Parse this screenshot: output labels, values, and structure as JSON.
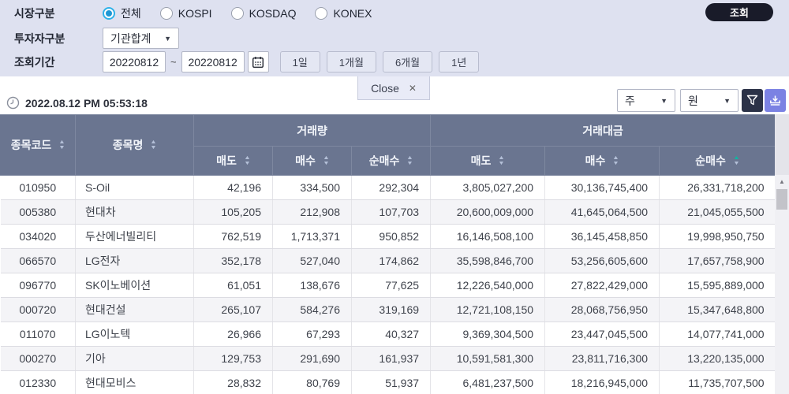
{
  "filters": {
    "market": {
      "label": "시장구분",
      "options": [
        {
          "label": "전체",
          "selected": true
        },
        {
          "label": "KOSPI",
          "selected": false
        },
        {
          "label": "KOSDAQ",
          "selected": false
        },
        {
          "label": "KONEX",
          "selected": false
        }
      ]
    },
    "investor": {
      "label": "투자자구분",
      "value": "기관합계"
    },
    "period": {
      "label": "조회기간",
      "from": "20220812",
      "separator": "~",
      "to": "20220812",
      "ranges": [
        "1일",
        "1개월",
        "6개월",
        "1년"
      ]
    },
    "search_button": "조회"
  },
  "tab": {
    "label": "Close",
    "close_icon": "✕"
  },
  "statusbar": {
    "timestamp": "2022.08.12 PM 05:53:18",
    "period_unit_select": "주",
    "currency_unit_select": "원"
  },
  "table": {
    "columns": {
      "code": "종목코드",
      "name": "종목명",
      "volume_group": "거래량",
      "value_group": "거래대금"
    },
    "sub_columns": [
      {
        "key": "vol-sell",
        "label": "매도",
        "active_sort": false
      },
      {
        "key": "vol-buy",
        "label": "매수",
        "active_sort": false
      },
      {
        "key": "vol-net",
        "label": "순매수",
        "active_sort": false
      },
      {
        "key": "val-sell",
        "label": "매도",
        "active_sort": false
      },
      {
        "key": "val-buy",
        "label": "매수",
        "active_sort": false
      },
      {
        "key": "val-net",
        "label": "순매수",
        "active_sort": true
      }
    ],
    "sort": {
      "active_column": "거래대금 순매수",
      "highlighted_arrow": "up"
    },
    "rows": [
      {
        "code": "010950",
        "name": "S-Oil",
        "vol_sell": "42,196",
        "vol_buy": "334,500",
        "vol_net": "292,304",
        "val_sell": "3,805,027,200",
        "val_buy": "30,136,745,400",
        "val_net": "26,331,718,200"
      },
      {
        "code": "005380",
        "name": "현대차",
        "vol_sell": "105,205",
        "vol_buy": "212,908",
        "vol_net": "107,703",
        "val_sell": "20,600,009,000",
        "val_buy": "41,645,064,500",
        "val_net": "21,045,055,500"
      },
      {
        "code": "034020",
        "name": "두산에너빌리티",
        "vol_sell": "762,519",
        "vol_buy": "1,713,371",
        "vol_net": "950,852",
        "val_sell": "16,146,508,100",
        "val_buy": "36,145,458,850",
        "val_net": "19,998,950,750"
      },
      {
        "code": "066570",
        "name": "LG전자",
        "vol_sell": "352,178",
        "vol_buy": "527,040",
        "vol_net": "174,862",
        "val_sell": "35,598,846,700",
        "val_buy": "53,256,605,600",
        "val_net": "17,657,758,900"
      },
      {
        "code": "096770",
        "name": "SK이노베이션",
        "vol_sell": "61,051",
        "vol_buy": "138,676",
        "vol_net": "77,625",
        "val_sell": "12,226,540,000",
        "val_buy": "27,822,429,000",
        "val_net": "15,595,889,000"
      },
      {
        "code": "000720",
        "name": "현대건설",
        "vol_sell": "265,107",
        "vol_buy": "584,276",
        "vol_net": "319,169",
        "val_sell": "12,721,108,150",
        "val_buy": "28,068,756,950",
        "val_net": "15,347,648,800"
      },
      {
        "code": "011070",
        "name": "LG이노텍",
        "vol_sell": "26,966",
        "vol_buy": "67,293",
        "vol_net": "40,327",
        "val_sell": "9,369,304,500",
        "val_buy": "23,447,045,500",
        "val_net": "14,077,741,000"
      },
      {
        "code": "000270",
        "name": "기아",
        "vol_sell": "129,753",
        "vol_buy": "291,690",
        "vol_net": "161,937",
        "val_sell": "10,591,581,300",
        "val_buy": "23,811,716,300",
        "val_net": "13,220,135,000"
      },
      {
        "code": "012330",
        "name": "현대모비스",
        "vol_sell": "28,832",
        "vol_buy": "80,769",
        "vol_net": "51,937",
        "val_sell": "6,481,237,500",
        "val_buy": "18,216,945,000",
        "val_net": "11,735,707,500"
      }
    ]
  },
  "colors": {
    "panel_bg": "#dee1f0",
    "search_button_bg": "#191b29",
    "table_header_bg": "#6a7590",
    "active_sort": "#12b5a2",
    "radio_selected": "#2fb1e8",
    "filter_button_bg": "#2b3247",
    "download_button_bg": "#7b82e3"
  }
}
